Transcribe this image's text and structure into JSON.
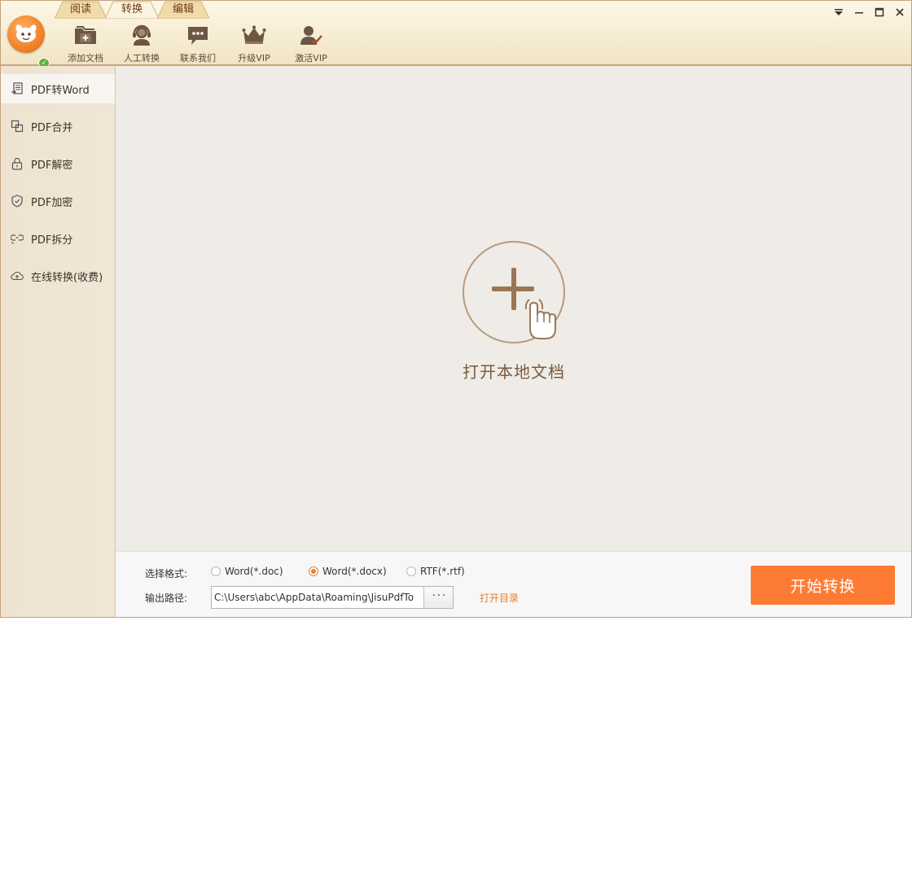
{
  "tabs": [
    {
      "label": "阅读"
    },
    {
      "label": "转换"
    },
    {
      "label": "编辑"
    }
  ],
  "active_tab": "转换",
  "toolbar": [
    {
      "label": "添加文档",
      "icon": "folder-add-icon"
    },
    {
      "label": "人工转换",
      "icon": "customer-service-icon"
    },
    {
      "label": "联系我们",
      "icon": "chat-bubble-icon"
    },
    {
      "label": "升级VIP",
      "icon": "crown-icon"
    },
    {
      "label": "激活VIP",
      "icon": "user-check-icon"
    }
  ],
  "sidebar": [
    {
      "label": "PDF转Word",
      "icon": "pdf-to-word-icon",
      "active": true
    },
    {
      "label": "PDF合并",
      "icon": "merge-icon"
    },
    {
      "label": "PDF解密",
      "icon": "unlock-icon"
    },
    {
      "label": "PDF加密",
      "icon": "shield-icon"
    },
    {
      "label": "PDF拆分",
      "icon": "split-icon"
    },
    {
      "label": "在线转换(收费)",
      "icon": "cloud-upload-icon"
    }
  ],
  "main": {
    "open_label": "打开本地文档"
  },
  "bottom": {
    "format_label": "选择格式:",
    "formats": [
      {
        "label": "Word(*.doc)",
        "checked": false
      },
      {
        "label": "Word(*.docx)",
        "checked": true
      },
      {
        "label": "RTF(*.rtf)",
        "checked": false
      }
    ],
    "path_label": "输出路径:",
    "path_value": "C:\\Users\\abc\\AppData\\Roaming\\JisuPdfTo",
    "browse_label": "···",
    "open_dir_label": "打开目录",
    "start_label": "开始转换"
  },
  "colors": {
    "accent": "#fd7b33",
    "tab_text": "#6b3a12",
    "icon_brown": "#6e5644",
    "border": "#c3a27a"
  }
}
